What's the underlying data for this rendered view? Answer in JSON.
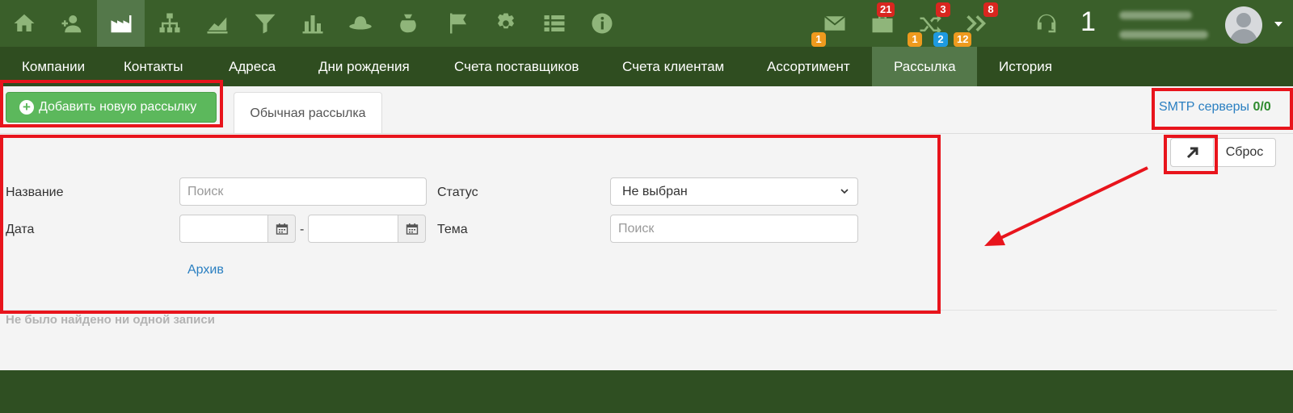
{
  "topbar": {
    "icons": [
      "home-icon",
      "contacts-icon",
      "factory-icon",
      "org-chart-icon",
      "area-chart-icon",
      "filter-icon",
      "bar-chart-icon",
      "hat-icon",
      "money-bag-icon",
      "flag-icon",
      "gear-icon",
      "list-icon",
      "info-icon"
    ],
    "right_icons": [
      {
        "name": "mail-icon",
        "badges": [
          {
            "text": "1",
            "color": "#ee9a1e"
          }
        ]
      },
      {
        "name": "briefcase-icon",
        "badges": [
          {
            "text": "21",
            "color": "#d9261f"
          }
        ]
      },
      {
        "name": "shuffle-icon",
        "badges": [
          {
            "text": "3",
            "color": "#d9261f"
          },
          {
            "text": "1",
            "color": "#ee9a1e"
          },
          {
            "text": "2",
            "color": "#1e9ae0"
          }
        ]
      },
      {
        "name": "double-chevron-icon",
        "badges": [
          {
            "text": "8",
            "color": "#d9261f"
          },
          {
            "text": "12",
            "color": "#ee9a1e"
          }
        ]
      },
      {
        "name": "headset-icon",
        "badges": []
      }
    ],
    "counter": "1",
    "avatar_icon": "user-avatar-icon"
  },
  "nav": {
    "items": [
      "Компании",
      "Контакты",
      "Адреса",
      "Дни рождения",
      "Счета поставщиков",
      "Счета клиентам",
      "Ассортимент",
      "Рассылка",
      "История"
    ],
    "active": "Рассылка"
  },
  "toolbar": {
    "add_button": "Добавить новую рассылку",
    "tab": "Обычная рассылка",
    "smtp_label": "SMTP серверы",
    "smtp_count": "0/0"
  },
  "filters": {
    "name_label": "Название",
    "name_placeholder": "Поиск",
    "status_label": "Статус",
    "status_value": "Не выбран",
    "date_label": "Дата",
    "date_separator": "-",
    "topic_label": "Тема",
    "topic_placeholder": "Поиск",
    "archive_link": "Архив",
    "expand_icon": "arrow-up-right-icon",
    "reset_button": "Сброс"
  },
  "results": {
    "empty_text": "Не было найдено ни одной записи"
  },
  "colors": {
    "topbar": "#3a5f2a",
    "navbar": "#2f4d20",
    "active_item": "#54784a",
    "add_button": "#5cb85c",
    "link": "#2a7fc1",
    "annotation": "#e8141c"
  }
}
